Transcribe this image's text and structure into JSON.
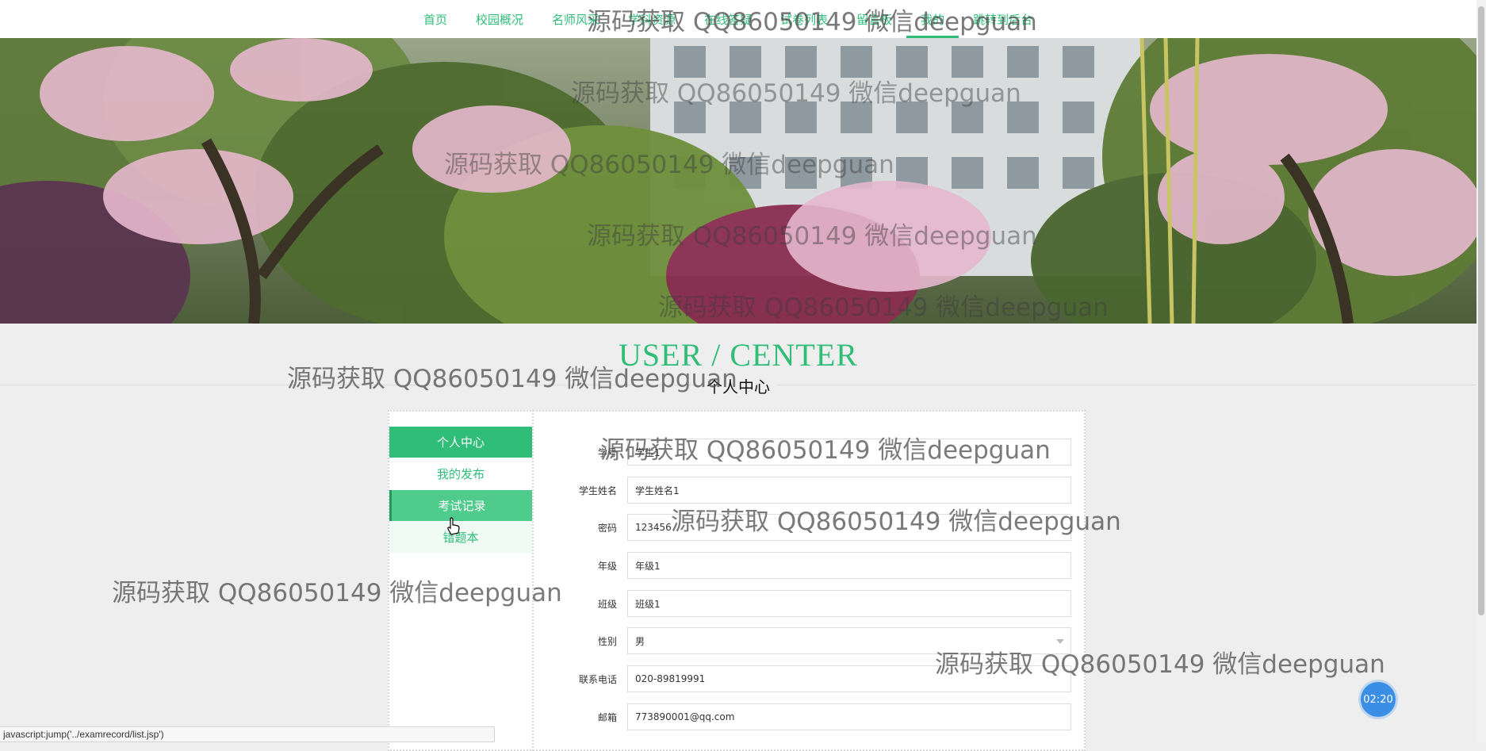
{
  "nav": {
    "items": [
      {
        "label": "首页",
        "active": false
      },
      {
        "label": "校园概况",
        "active": false
      },
      {
        "label": "名师风采",
        "active": false
      },
      {
        "label": "学科资源",
        "active": false
      },
      {
        "label": "在线答疑",
        "active": false
      },
      {
        "label": "试卷列表",
        "active": false
      },
      {
        "label": "留言板",
        "active": false
      },
      {
        "label": "我的",
        "active": true
      },
      {
        "label": "跳转到后台",
        "active": false
      }
    ]
  },
  "center": {
    "title": "USER / CENTER",
    "subtitle": "个人中心"
  },
  "sidebar": {
    "items": [
      {
        "label": "个人中心"
      },
      {
        "label": "我的发布"
      },
      {
        "label": "考试记录"
      },
      {
        "label": "错题本"
      }
    ]
  },
  "form": {
    "fields": [
      {
        "label": "学号",
        "value": "学生1"
      },
      {
        "label": "学生姓名",
        "value": "学生姓名1"
      },
      {
        "label": "密码",
        "value": "123456"
      },
      {
        "label": "年级",
        "value": "年级1"
      },
      {
        "label": "班级",
        "value": "班级1"
      },
      {
        "label": "性别",
        "value": "男"
      },
      {
        "label": "联系电话",
        "value": "020-89819991"
      },
      {
        "label": "邮箱",
        "value": "773890001@qq.com"
      }
    ]
  },
  "watermark": "源码获取 QQ86050149 微信deepguan",
  "statusbar": "javascript:jump('../examrecord/list.jsp')",
  "timer": "02:20",
  "colors": {
    "accent": "#2fbd78",
    "timer": "#3a8ee6"
  }
}
